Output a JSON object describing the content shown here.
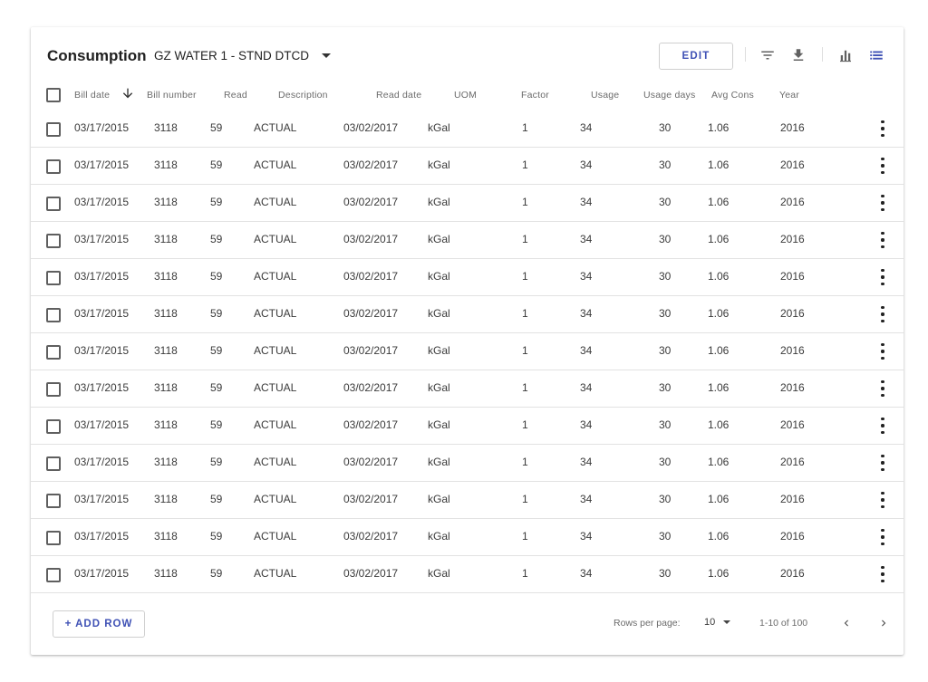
{
  "toolbar": {
    "title": "Consumption",
    "meter_select": "GZ WATER 1 - STND DTCD",
    "edit_label": "EDIT",
    "icons": [
      "filter-icon",
      "download-icon",
      "bar-chart-icon",
      "list-view-icon"
    ]
  },
  "table": {
    "columns": [
      "Bill date",
      "Bill number",
      "Read",
      "Description",
      "Read date",
      "UOM",
      "Factor",
      "Usage",
      "Usage days",
      "Avg Cons",
      "Year"
    ],
    "sort": {
      "column": "Bill date",
      "direction": "descending"
    },
    "rows": [
      [
        "03/17/2015",
        "3118",
        "59",
        "ACTUAL",
        "03/02/2017",
        "kGal",
        "1",
        "34",
        "30",
        "1.06",
        "2016"
      ],
      [
        "03/17/2015",
        "3118",
        "59",
        "ACTUAL",
        "03/02/2017",
        "kGal",
        "1",
        "34",
        "30",
        "1.06",
        "2016"
      ],
      [
        "03/17/2015",
        "3118",
        "59",
        "ACTUAL",
        "03/02/2017",
        "kGal",
        "1",
        "34",
        "30",
        "1.06",
        "2016"
      ],
      [
        "03/17/2015",
        "3118",
        "59",
        "ACTUAL",
        "03/02/2017",
        "kGal",
        "1",
        "34",
        "30",
        "1.06",
        "2016"
      ],
      [
        "03/17/2015",
        "3118",
        "59",
        "ACTUAL",
        "03/02/2017",
        "kGal",
        "1",
        "34",
        "30",
        "1.06",
        "2016"
      ],
      [
        "03/17/2015",
        "3118",
        "59",
        "ACTUAL",
        "03/02/2017",
        "kGal",
        "1",
        "34",
        "30",
        "1.06",
        "2016"
      ],
      [
        "03/17/2015",
        "3118",
        "59",
        "ACTUAL",
        "03/02/2017",
        "kGal",
        "1",
        "34",
        "30",
        "1.06",
        "2016"
      ],
      [
        "03/17/2015",
        "3118",
        "59",
        "ACTUAL",
        "03/02/2017",
        "kGal",
        "1",
        "34",
        "30",
        "1.06",
        "2016"
      ],
      [
        "03/17/2015",
        "3118",
        "59",
        "ACTUAL",
        "03/02/2017",
        "kGal",
        "1",
        "34",
        "30",
        "1.06",
        "2016"
      ],
      [
        "03/17/2015",
        "3118",
        "59",
        "ACTUAL",
        "03/02/2017",
        "kGal",
        "1",
        "34",
        "30",
        "1.06",
        "2016"
      ],
      [
        "03/17/2015",
        "3118",
        "59",
        "ACTUAL",
        "03/02/2017",
        "kGal",
        "1",
        "34",
        "30",
        "1.06",
        "2016"
      ],
      [
        "03/17/2015",
        "3118",
        "59",
        "ACTUAL",
        "03/02/2017",
        "kGal",
        "1",
        "34",
        "30",
        "1.06",
        "2016"
      ],
      [
        "03/17/2015",
        "3118",
        "59",
        "ACTUAL",
        "03/02/2017",
        "kGal",
        "1",
        "34",
        "30",
        "1.06",
        "2016"
      ]
    ]
  },
  "footer": {
    "add_row_label": "+ ADD ROW",
    "rows_per_page_label": "Rows per page:",
    "rows_per_page_value": "10",
    "range_text": "1-10 of 100"
  },
  "colors": {
    "accent": "#3f51b5",
    "active_view_icon": "#3f51b5",
    "icon": "#616161"
  }
}
